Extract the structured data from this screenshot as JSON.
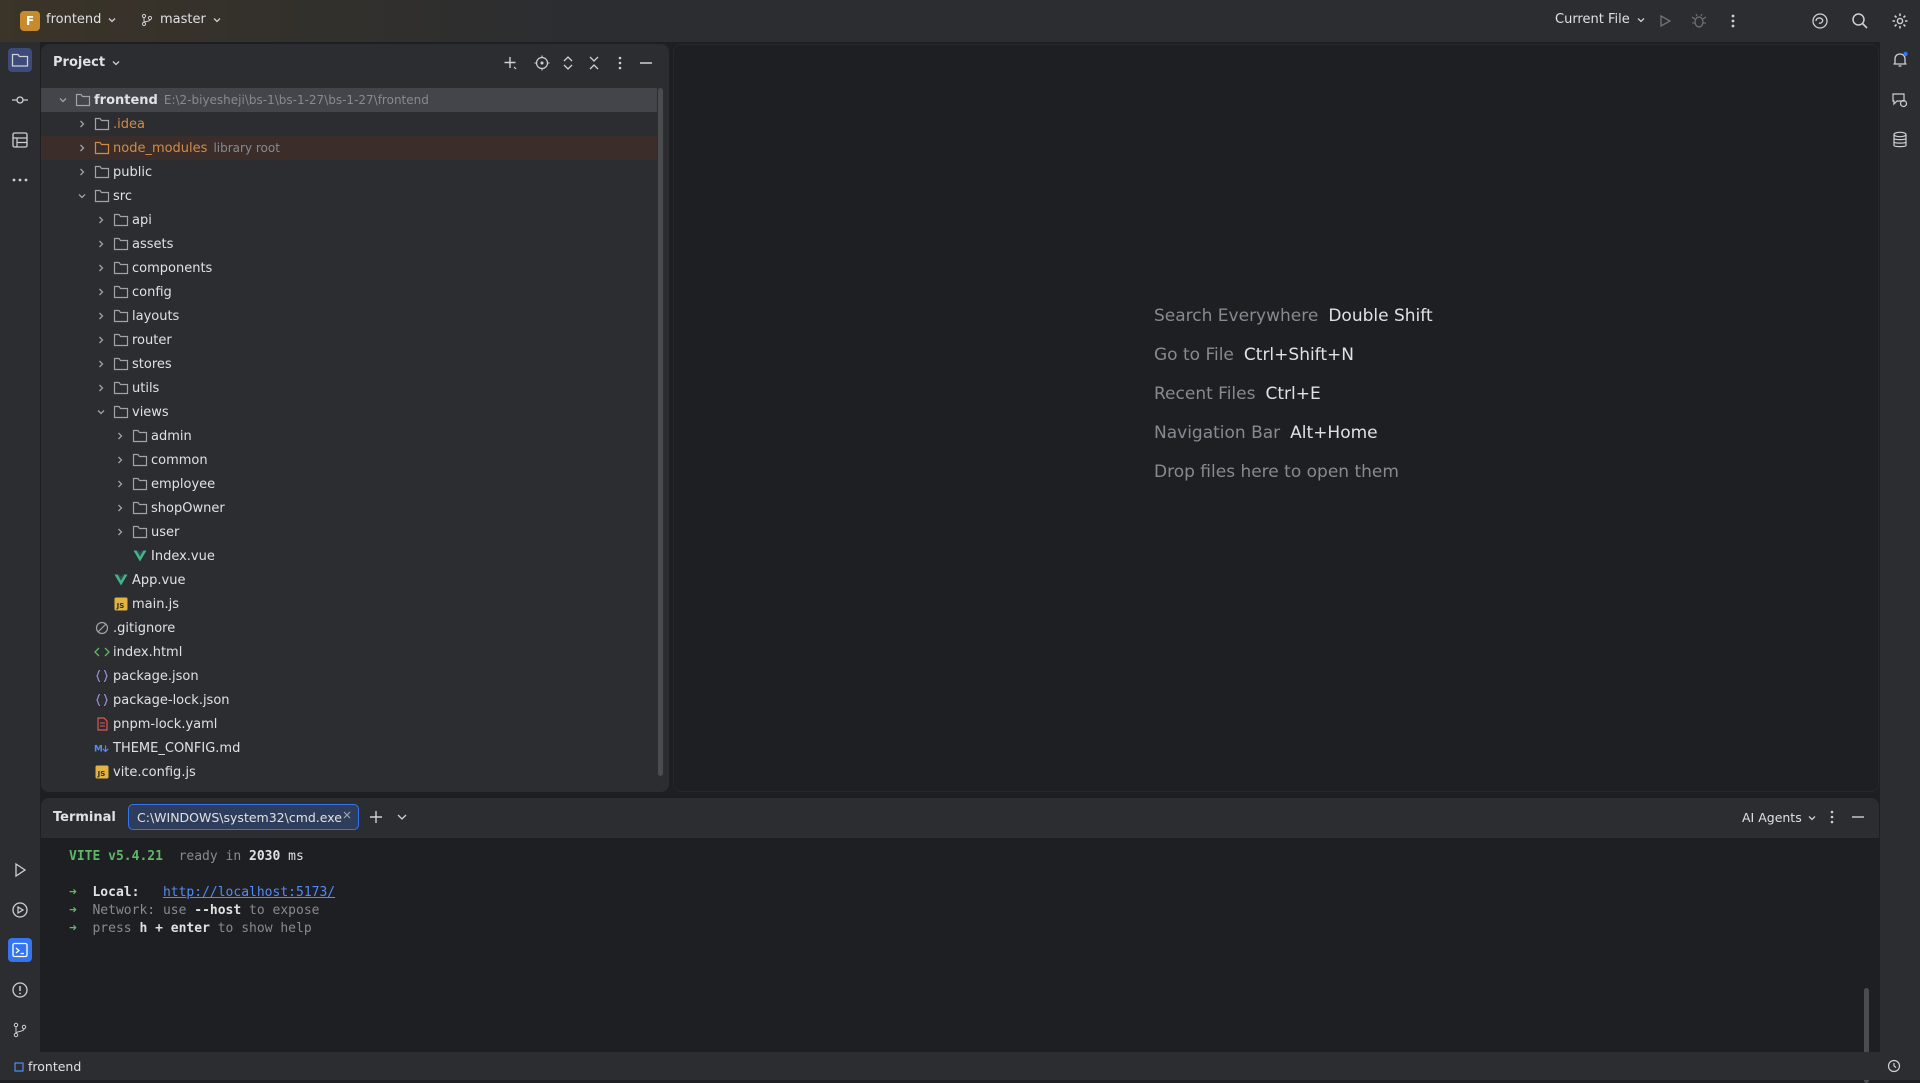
{
  "titlebar": {
    "project_badge": "F",
    "project_name": "frontend",
    "branch": "master",
    "run_config": "Current File"
  },
  "project_panel": {
    "title": "Project",
    "tree": [
      {
        "label": "frontend",
        "hint": "E:\\2-biyesheji\\bs-1\\bs-1-27\\bs-1-27\\frontend",
        "depth": 0,
        "expanded": true,
        "kind": "folder",
        "style": "bold",
        "selected": true
      },
      {
        "label": ".idea",
        "depth": 1,
        "expanded": false,
        "kind": "folder",
        "style": "orange"
      },
      {
        "label": "node_modules",
        "hint": "library root",
        "depth": 1,
        "expanded": false,
        "kind": "folder-lib",
        "style": "orange",
        "lib": true
      },
      {
        "label": "public",
        "depth": 1,
        "expanded": false,
        "kind": "folder"
      },
      {
        "label": "src",
        "depth": 1,
        "expanded": true,
        "kind": "folder"
      },
      {
        "label": "api",
        "depth": 2,
        "expanded": false,
        "kind": "folder"
      },
      {
        "label": "assets",
        "depth": 2,
        "expanded": false,
        "kind": "folder"
      },
      {
        "label": "components",
        "depth": 2,
        "expanded": false,
        "kind": "folder"
      },
      {
        "label": "config",
        "depth": 2,
        "expanded": false,
        "kind": "folder"
      },
      {
        "label": "layouts",
        "depth": 2,
        "expanded": false,
        "kind": "folder"
      },
      {
        "label": "router",
        "depth": 2,
        "expanded": false,
        "kind": "folder"
      },
      {
        "label": "stores",
        "depth": 2,
        "expanded": false,
        "kind": "folder"
      },
      {
        "label": "utils",
        "depth": 2,
        "expanded": false,
        "kind": "folder"
      },
      {
        "label": "views",
        "depth": 2,
        "expanded": true,
        "kind": "folder"
      },
      {
        "label": "admin",
        "depth": 3,
        "expanded": false,
        "kind": "folder"
      },
      {
        "label": "common",
        "depth": 3,
        "expanded": false,
        "kind": "folder"
      },
      {
        "label": "employee",
        "depth": 3,
        "expanded": false,
        "kind": "folder"
      },
      {
        "label": "shopOwner",
        "depth": 3,
        "expanded": false,
        "kind": "folder"
      },
      {
        "label": "user",
        "depth": 3,
        "expanded": false,
        "kind": "folder"
      },
      {
        "label": "Index.vue",
        "depth": 3,
        "kind": "vue"
      },
      {
        "label": "App.vue",
        "depth": 2,
        "kind": "vue"
      },
      {
        "label": "main.js",
        "depth": 2,
        "kind": "js"
      },
      {
        "label": ".gitignore",
        "depth": 1,
        "kind": "ignore"
      },
      {
        "label": "index.html",
        "depth": 1,
        "kind": "html"
      },
      {
        "label": "package.json",
        "depth": 1,
        "kind": "json"
      },
      {
        "label": "package-lock.json",
        "depth": 1,
        "kind": "json"
      },
      {
        "label": "pnpm-lock.yaml",
        "depth": 1,
        "kind": "yaml"
      },
      {
        "label": "THEME_CONFIG.md",
        "depth": 1,
        "kind": "md"
      },
      {
        "label": "vite.config.js",
        "depth": 1,
        "kind": "js"
      }
    ]
  },
  "editor": {
    "shortcuts": [
      {
        "name": "Search Everywhere",
        "key": "Double Shift"
      },
      {
        "name": "Go to File",
        "key": "Ctrl+Shift+N"
      },
      {
        "name": "Recent Files",
        "key": "Ctrl+E"
      },
      {
        "name": "Navigation Bar",
        "key": "Alt+Home"
      }
    ],
    "drop_hint": "Drop files here to open them"
  },
  "terminal": {
    "title": "Terminal",
    "tab_label": "C:\\WINDOWS\\system32\\cmd.exe",
    "agents_label": "AI Agents",
    "vite_name": "VITE v5.4.21",
    "ready_text": "ready in",
    "ready_ms": "2030",
    "ms_unit": "ms",
    "arrow": "➜",
    "local_label": "Local:",
    "local_url": "http://localhost:5173/",
    "network_label": "Network:",
    "network_use": "use",
    "network_flag": "--host",
    "network_rest": "to expose",
    "press_text": "press",
    "press_keys": "h + enter",
    "press_rest": "to show help"
  },
  "statusbar": {
    "project": "frontend"
  },
  "colors": {
    "accent": "#3574f0",
    "folder": "#a0a3a9",
    "vue": "#41b883",
    "js": "#e3b341",
    "orange_label": "#d08c4a",
    "term_green": "#5fb865"
  }
}
